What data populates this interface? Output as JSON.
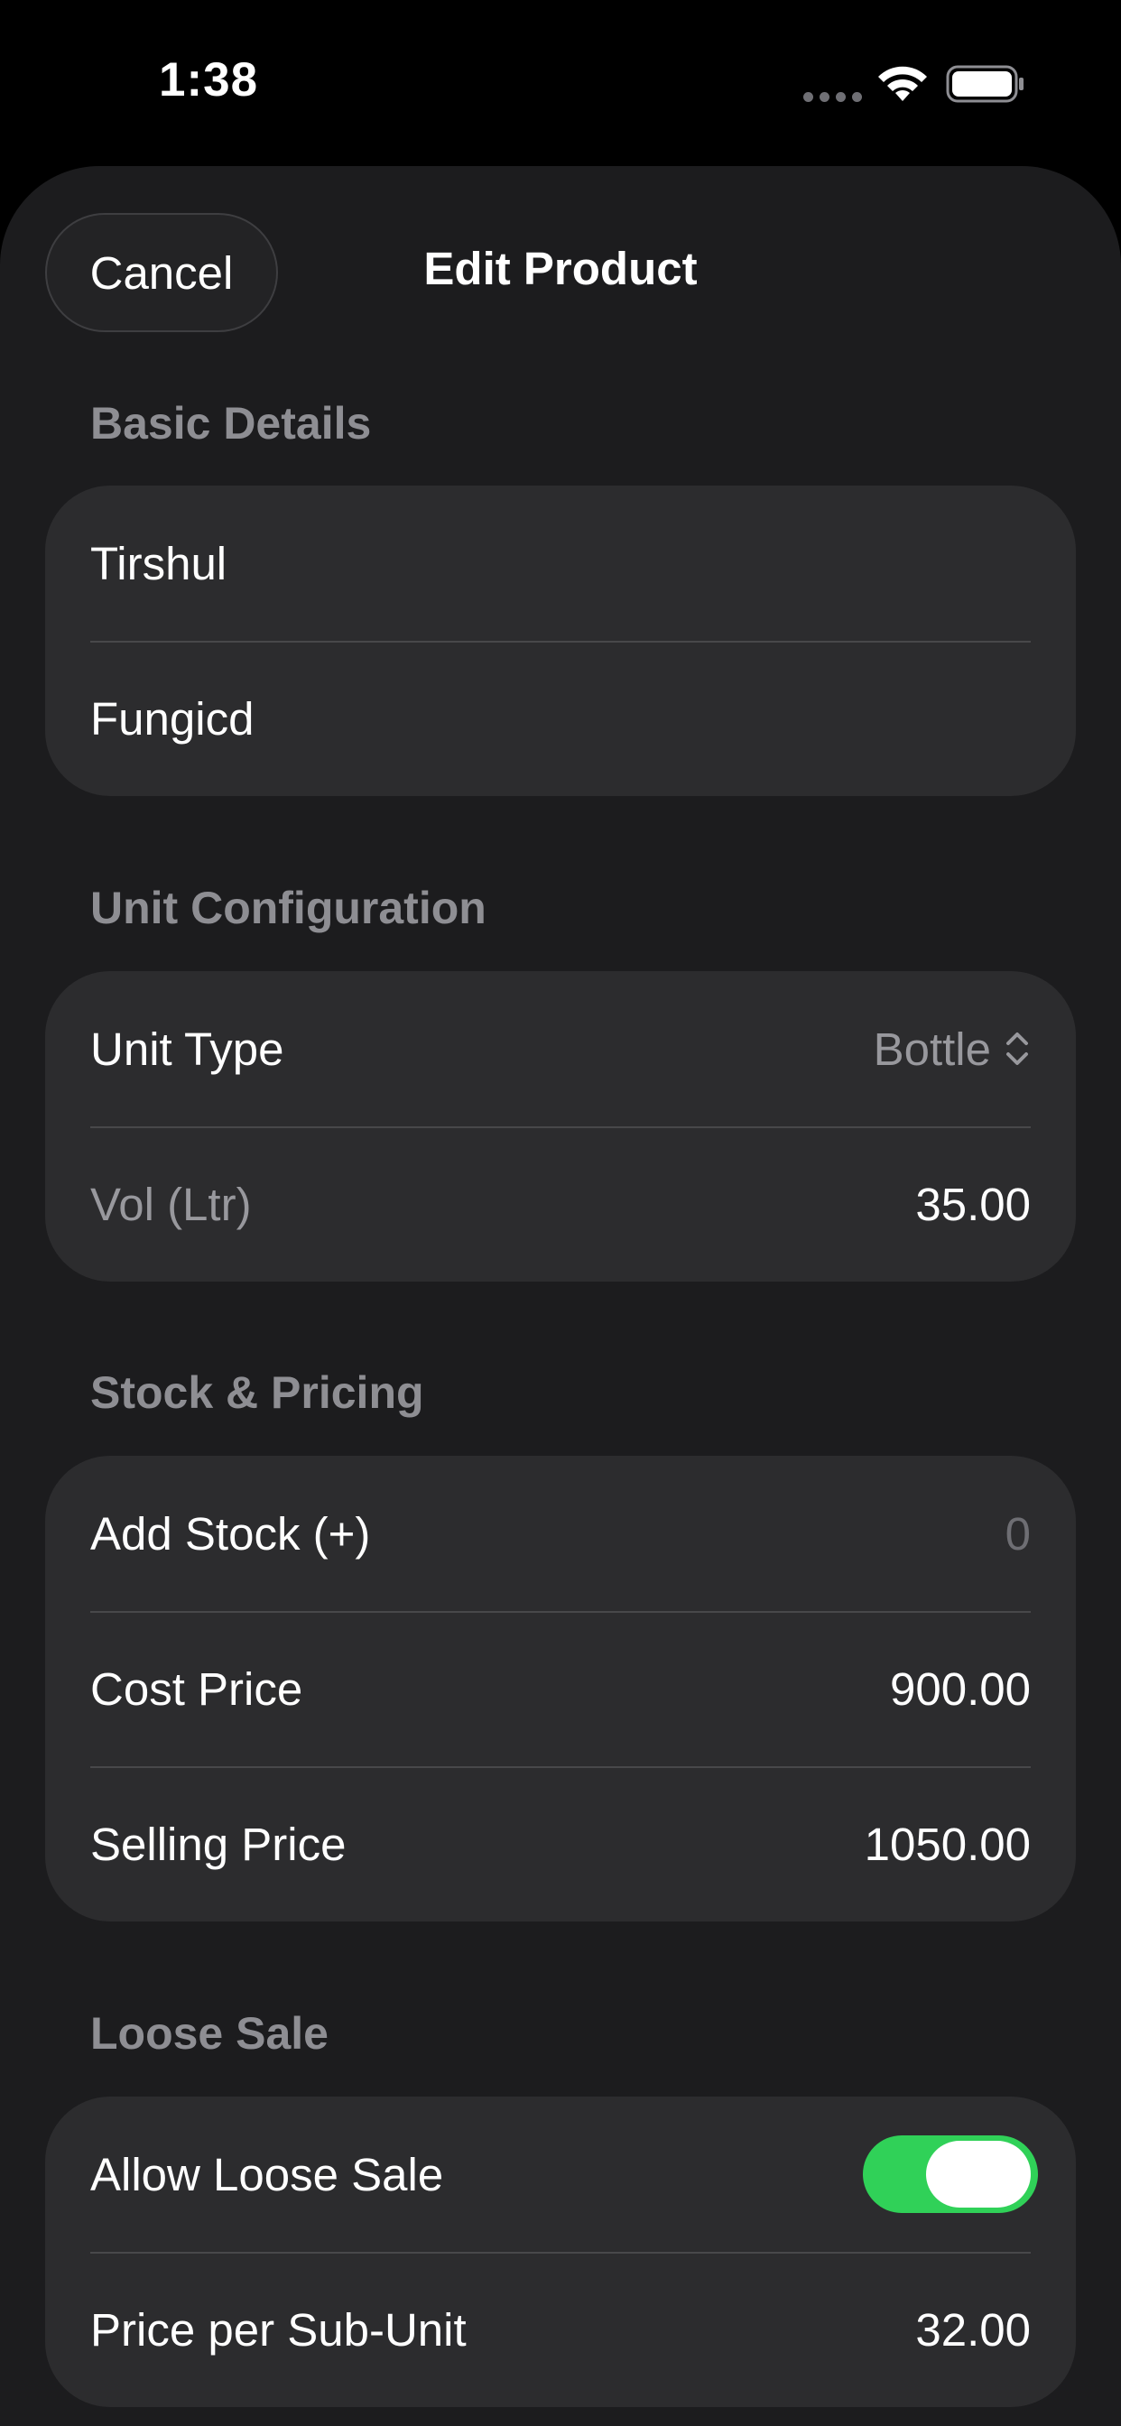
{
  "status_bar": {
    "time": "1:38"
  },
  "sheet": {
    "title": "Edit Product",
    "cancel_label": "Cancel"
  },
  "sections": {
    "basic": {
      "header": "Basic Details",
      "name_value": "Tirshul",
      "category_value": "Fungicd"
    },
    "unit": {
      "header": "Unit Configuration",
      "unit_type_label": "Unit Type",
      "unit_type_value": "Bottle",
      "volume_label": "Vol (Ltr)",
      "volume_value": "35.00"
    },
    "stock": {
      "header": "Stock & Pricing",
      "add_stock_label": "Add Stock (+)",
      "add_stock_placeholder": "0",
      "cost_price_label": "Cost Price",
      "cost_price_value": "900.00",
      "selling_price_label": "Selling Price",
      "selling_price_value": "1050.00"
    },
    "loose": {
      "header": "Loose Sale",
      "allow_label": "Allow Loose Sale",
      "allow_on": true,
      "price_sub_label": "Price per Sub-Unit",
      "price_sub_value": "32.00"
    }
  },
  "colors": {
    "background": "#1c1c1e",
    "group": "#2c2c2e",
    "secondary_text": "#8e8e93",
    "toggle_on": "#30d158"
  },
  "icons": [
    "wifi-icon",
    "battery-icon",
    "chevron-up-down-icon"
  ]
}
